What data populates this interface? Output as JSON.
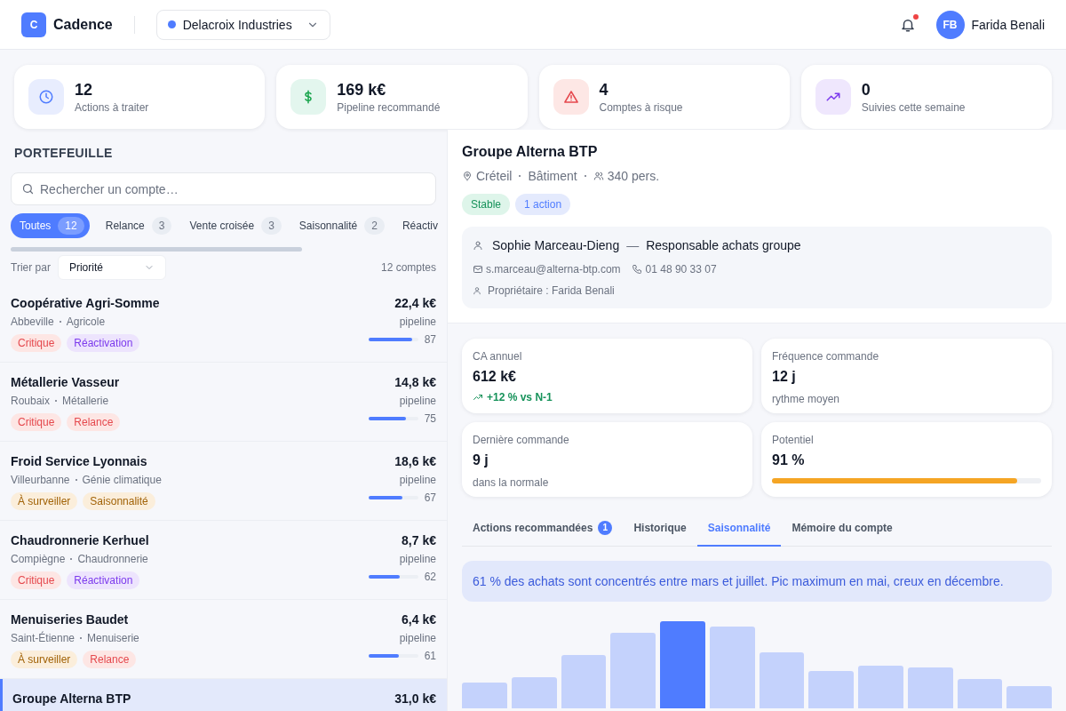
{
  "app": {
    "logo_letter": "C",
    "name": "Cadence",
    "workspace": "Delacroix Industries",
    "user_initials": "FB",
    "user_name": "Farida Benali",
    "notification": true
  },
  "kpis": [
    {
      "kind": "clock",
      "value": "12",
      "label": "Actions à traiter"
    },
    {
      "kind": "money",
      "value": "169 k€",
      "label": "Pipeline recommandé"
    },
    {
      "kind": "alert",
      "value": "4",
      "label": "Comptes à risque"
    },
    {
      "kind": "trend",
      "value": "0",
      "label": "Suivies cette semaine"
    }
  ],
  "portfolio": {
    "title": "PORTEFEUILLE",
    "search": {
      "placeholder": "Rechercher un compte…"
    },
    "filters": [
      {
        "label": "Toutes",
        "count": "12",
        "selected": true
      },
      {
        "label": "Relance",
        "count": "3",
        "selected": false
      },
      {
        "label": "Vente croisée",
        "count": "3",
        "selected": false
      },
      {
        "label": "Saisonnalité",
        "count": "2",
        "selected": false
      },
      {
        "label": "Réactiv",
        "selected": false
      }
    ],
    "sort_label": "Trier par",
    "sort_value": "Priorité",
    "total": "12 comptes",
    "accounts": [
      {
        "name": "Coopérative Agri-Somme",
        "city": "Abbeville",
        "sector": "Agricole",
        "tags": [
          {
            "label": "Critique",
            "kind": "red"
          },
          {
            "label": "Réactivation",
            "kind": "purple"
          }
        ],
        "amount": "22,4 k€",
        "amount_label": "pipeline",
        "level": 0.87,
        "score": "87",
        "selected": false
      },
      {
        "name": "Métallerie Vasseur",
        "city": "Roubaix",
        "sector": "Métallerie",
        "tags": [
          {
            "label": "Critique",
            "kind": "red"
          },
          {
            "label": "Relance",
            "kind": "red"
          }
        ],
        "amount": "14,8 k€",
        "amount_label": "pipeline",
        "level": 0.75,
        "score": "75",
        "selected": false
      },
      {
        "name": "Froid Service Lyonnais",
        "city": "Villeurbanne",
        "sector": "Génie climatique",
        "tags": [
          {
            "label": "À surveiller",
            "kind": "amber"
          },
          {
            "label": "Saisonnalité",
            "kind": "amber"
          }
        ],
        "amount": "18,6 k€",
        "amount_label": "pipeline",
        "level": 0.67,
        "score": "67",
        "selected": false
      },
      {
        "name": "Chaudronnerie Kerhuel",
        "city": "Compiègne",
        "sector": "Chaudronnerie",
        "tags": [
          {
            "label": "Critique",
            "kind": "red"
          },
          {
            "label": "Réactivation",
            "kind": "purple"
          }
        ],
        "amount": "8,7 k€",
        "amount_label": "pipeline",
        "level": 0.62,
        "score": "62",
        "selected": false
      },
      {
        "name": "Menuiseries Baudet",
        "city": "Saint-Étienne",
        "sector": "Menuiserie",
        "tags": [
          {
            "label": "À surveiller",
            "kind": "amber"
          },
          {
            "label": "Relance",
            "kind": "red"
          }
        ],
        "amount": "6,4 k€",
        "amount_label": "pipeline",
        "level": 0.61,
        "score": "61",
        "selected": false
      },
      {
        "name": "Groupe Alterna BTP",
        "amount": "31,0 k€",
        "selected": true
      }
    ]
  },
  "detail": {
    "name": "Groupe Alterna BTP",
    "city": "Créteil",
    "sector": "Bâtiment",
    "headcount": "340 pers.",
    "badges": [
      {
        "label": "Stable",
        "kind": "green"
      },
      {
        "label": "1 action",
        "kind": "blue"
      }
    ],
    "contact": {
      "name": "Sophie Marceau-Dieng",
      "separator": "—",
      "role": "Responsable achats groupe",
      "email": "s.marceau@alterna-btp.com",
      "phone": "01 48 90 33 07",
      "owner": "Propriétaire : Farida Benali"
    },
    "metrics": [
      {
        "kind": "trend",
        "label": "CA annuel",
        "value": "612 k€",
        "note": "+12 % vs N-1"
      },
      {
        "kind": "text",
        "label": "Fréquence commande",
        "value": "12 j",
        "note": "rythme moyen"
      },
      {
        "kind": "text",
        "label": "Dernière commande",
        "value": "9 j",
        "note": "dans la normale"
      },
      {
        "kind": "bar",
        "label": "Potentiel",
        "value": "91 %",
        "level": 0.91
      }
    ],
    "tabs": [
      {
        "label": "Actions recommandées",
        "count": "1",
        "selected": false
      },
      {
        "label": "Historique",
        "selected": false
      },
      {
        "label": "Saisonnalité",
        "selected": true
      },
      {
        "label": "Mémoire du compte",
        "selected": false
      }
    ],
    "insight": "61 % des achats sont concentrés entre mars et juillet. Pic maximum en mai, creux en décembre."
  }
}
